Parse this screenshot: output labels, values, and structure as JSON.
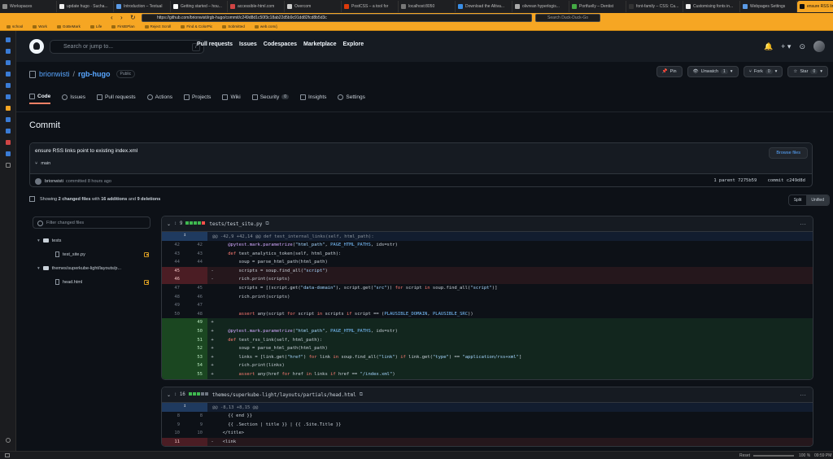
{
  "browser": {
    "tabs": [
      {
        "label": "Workspaces",
        "color": "#8b8b8b"
      },
      {
        "label": "update hugo · Sucha...",
        "color": "#eeeeee"
      },
      {
        "label": "Introduction – Textual",
        "color": "#5a9ae6"
      },
      {
        "label": "Getting started – hou...",
        "color": "#ffffff"
      },
      {
        "label": "accessible-html.com",
        "color": "#d14545"
      },
      {
        "label": "Overcom",
        "color": "#cccccc"
      },
      {
        "label": "PostCSS – a tool for",
        "color": "#dd3a0a"
      },
      {
        "label": "localhost:8050",
        "color": "#777777"
      },
      {
        "label": "Download the Altiva...",
        "color": "#3a8ee6"
      },
      {
        "label": "olivrean hyperlogis...",
        "color": "#aaaaaa"
      },
      {
        "label": "Portfuelly – Dentist",
        "color": "#44aa44"
      },
      {
        "label": "font-family – CSS: Ca...",
        "color": "#333333"
      },
      {
        "label": "Customising fonts in...",
        "color": "#eeeeee"
      },
      {
        "label": "Webpages Settings",
        "color": "#5a9ae6"
      },
      {
        "label": "ensure RSS links point",
        "color": "#111111"
      },
      {
        "label": "realistic/ensure repl...",
        "color": "#eeeeee"
      }
    ],
    "active_tab": 14,
    "url": "https://github.com/brionwisti/rgb-hugo/commit/c249d8d1c50f3c18ab22d5b9c91dd82fcd8b5d3c",
    "search_placeholder": "Search Duck-Duck-Go",
    "bookmarks": [
      "school",
      "Work",
      "GoBeMark",
      "Life",
      "FirstEPlan",
      "Reject Scroll",
      "Find & ColorPic",
      "Sobmitted",
      "web.com/j"
    ]
  },
  "github": {
    "search_placeholder": "Search or jump to...",
    "search_shortcut": "/",
    "nav": [
      "Pull requests",
      "Issues",
      "Codespaces",
      "Marketplace",
      "Explore"
    ],
    "owner": "brionwisti",
    "separator": "/",
    "repo": "rgb-hugo",
    "visibility": "Public",
    "actions": {
      "pin": "Pin",
      "unwatch": "Unwatch",
      "unwatch_count": "1",
      "fork": "Fork",
      "fork_count": "0",
      "star": "Star",
      "star_count": "0"
    },
    "tabs": [
      {
        "label": "Code",
        "icon": "code-icon",
        "active": true
      },
      {
        "label": "Issues",
        "icon": "issue-icon"
      },
      {
        "label": "Pull requests",
        "icon": "pull-request-icon"
      },
      {
        "label": "Actions",
        "icon": "play-icon"
      },
      {
        "label": "Projects",
        "icon": "table-icon"
      },
      {
        "label": "Wiki",
        "icon": "book-icon"
      },
      {
        "label": "Security",
        "icon": "shield-icon",
        "badge": "0"
      },
      {
        "label": "Insights",
        "icon": "graph-icon"
      },
      {
        "label": "Settings",
        "icon": "gear-icon"
      }
    ]
  },
  "commit": {
    "heading": "Commit",
    "title": "ensure RSS links point to existing index.xml",
    "branch": "main",
    "browse_files": "Browse files",
    "author": "brionwisti",
    "meta": "committed 8 hours ago",
    "parent_label": "1 parent",
    "parent_sha": "7275b59",
    "commit_label": "commit",
    "commit_sha": "c249d8d"
  },
  "summary": {
    "prefix": "Showing",
    "changed": "2 changed files",
    "with": "with",
    "additions": "16 additions",
    "and": "and",
    "deletions": "9 deletions",
    "split": "Split",
    "unified": "Unified"
  },
  "filetree": {
    "filter_placeholder": "Filter changed files",
    "items": [
      {
        "type": "folder",
        "label": "tests",
        "depth": 0
      },
      {
        "type": "file",
        "label": "test_site.py",
        "depth": 1
      },
      {
        "type": "folder",
        "label": "themes/superkube-light/layouts/p...",
        "depth": 0
      },
      {
        "type": "file",
        "label": "head.html",
        "depth": 1
      }
    ]
  },
  "diffs": [
    {
      "changes": "9",
      "path": "tests/test_site.py",
      "hunk": "@@ -42,9 +42,14 @@ def test_internal_links(self, html_path):",
      "lines": [
        {
          "t": "ctx",
          "o": "42",
          "n": "42",
          "code": "    @pytest.mark.parametrize(\"html_path\", PAGE_HTML_PATHS, ids=str)"
        },
        {
          "t": "ctx",
          "o": "43",
          "n": "43",
          "code": "    def test_analytics_token(self, html_path):"
        },
        {
          "t": "ctx",
          "o": "44",
          "n": "44",
          "code": "        soup = parse_html_path(html_path)"
        },
        {
          "t": "del",
          "o": "45",
          "n": "",
          "code": "        scripts = soup.find_all(\"script\")"
        },
        {
          "t": "del",
          "o": "46",
          "n": "",
          "code": "        rich.print(scripts)"
        },
        {
          "t": "ctx",
          "o": "47",
          "n": "45",
          "code": "        scripts = [(script.get(\"data-domain\"), script.get(\"src\")) for script in soup.find_all(\"script\")]"
        },
        {
          "t": "ctx",
          "o": "48",
          "n": "46",
          "code": "        rich.print(scripts)"
        },
        {
          "t": "ctx",
          "o": "49",
          "n": "47",
          "code": ""
        },
        {
          "t": "ctx",
          "o": "50",
          "n": "48",
          "code": "        assert any(script for script in scripts if script == (PLAUSIBLE_DOMAIN, PLAUSIBLE_SRC))"
        },
        {
          "t": "add",
          "o": "",
          "n": "49",
          "code": ""
        },
        {
          "t": "add",
          "o": "",
          "n": "50",
          "code": "    @pytest.mark.parametrize(\"html_path\", PAGE_HTML_PATHS, ids=str)"
        },
        {
          "t": "add",
          "o": "",
          "n": "51",
          "code": "    def test_rss_link(self, html_path):"
        },
        {
          "t": "add",
          "o": "",
          "n": "52",
          "code": "        soup = parse_html_path(html_path)"
        },
        {
          "t": "add",
          "o": "",
          "n": "53",
          "code": "        links = [link.get(\"href\") for link in soup.find_all(\"link\") if link.get(\"type\") == \"application/rss+xml\"]"
        },
        {
          "t": "add",
          "o": "",
          "n": "54",
          "code": "        rich.print(links)"
        },
        {
          "t": "add",
          "o": "",
          "n": "55",
          "code": "        assert any(href for href in links if href == \"/index.xml\")"
        }
      ]
    },
    {
      "changes": "16",
      "path": "themes/superkube-light/layouts/partials/head.html",
      "hunk": "@@ -8,13 +8,15 @@",
      "lines": [
        {
          "t": "ctx",
          "o": "8",
          "n": "8",
          "code": "    {{ end }}"
        },
        {
          "t": "ctx",
          "o": "9",
          "n": "9",
          "code": "    {{ .Section | title }} | {{ .Site.Title }}"
        },
        {
          "t": "ctx",
          "o": "10",
          "n": "10",
          "code": "  </title>"
        },
        {
          "t": "del",
          "o": "11",
          "n": "",
          "code": "  <link"
        }
      ]
    }
  ],
  "status": {
    "reset": "Reset",
    "zoom": "100 %",
    "time": "09:59 PM"
  },
  "colors": {
    "accent_tab": "#f6a623",
    "link": "#58a6ff",
    "addition": "#3fb950",
    "deletion": "#f85149"
  }
}
